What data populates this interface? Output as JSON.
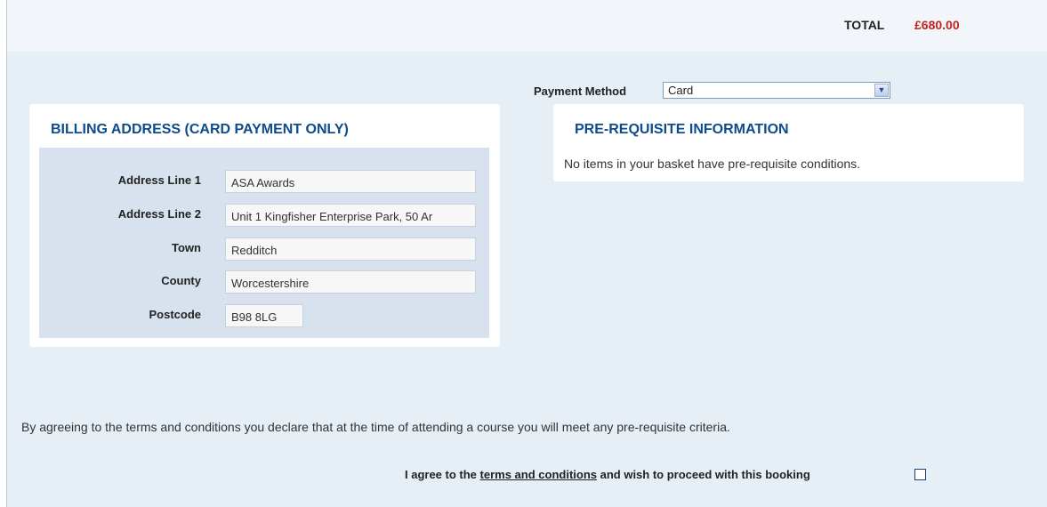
{
  "summary": {
    "total_label": "TOTAL",
    "total_value": "£680.00"
  },
  "payment": {
    "label": "Payment Method",
    "selected": "Card"
  },
  "billing": {
    "title": "BILLING ADDRESS (CARD PAYMENT ONLY)",
    "fields": [
      {
        "label": "Address Line 1",
        "value": "ASA Awards"
      },
      {
        "label": "Address Line 2",
        "value": "Unit 1 Kingfisher Enterprise Park, 50 Ar"
      },
      {
        "label": "Town",
        "value": "Redditch"
      },
      {
        "label": "County",
        "value": "Worcestershire"
      },
      {
        "label": "Postcode",
        "value": "B98 8LG"
      }
    ]
  },
  "prereq": {
    "title": "PRE-REQUISITE INFORMATION",
    "message": "No items in your basket have pre-requisite conditions."
  },
  "terms": {
    "declaration": "By agreeing to the terms and conditions you declare that at the time of attending a course you will meet any pre-requisite criteria.",
    "agree_prefix": "I agree to the ",
    "agree_link": "terms and conditions",
    "agree_suffix": " and wish to proceed with this booking",
    "checked": false
  },
  "icons": {
    "dropdown": "chevron-down-icon"
  },
  "colors": {
    "heading": "#0e4b8b",
    "total": "#c0251b",
    "panel_bg": "#e6eef6"
  }
}
